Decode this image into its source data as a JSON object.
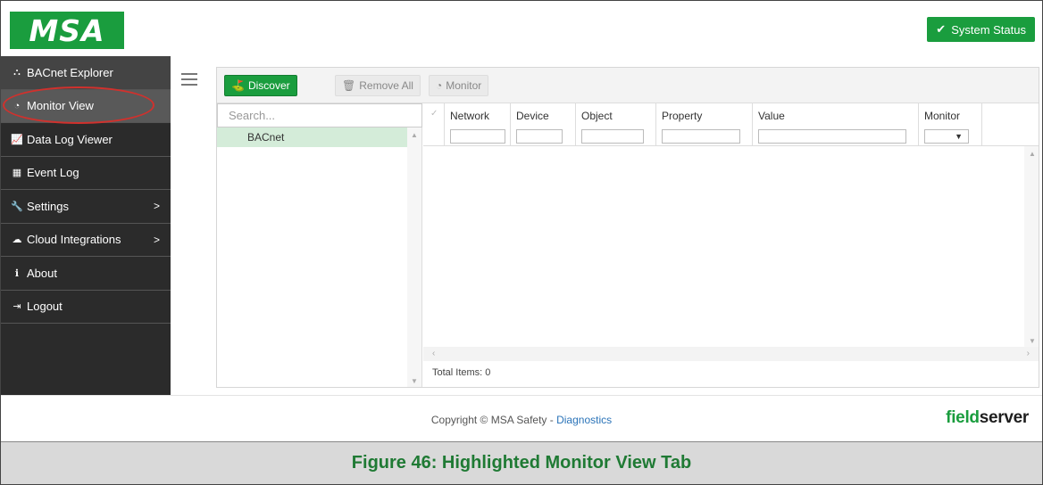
{
  "brand": {
    "logo_text": "MSA",
    "accent": "#1a9d3e",
    "sidebar_bg": "#2b2b2b"
  },
  "header": {
    "system_status_label": "System Status",
    "system_status_icon": "check-icon"
  },
  "sidebar": {
    "items": [
      {
        "label": "BACnet Explorer",
        "icon": "sitemap-icon"
      },
      {
        "label": "Monitor View",
        "icon": "tachometer-icon"
      },
      {
        "label": "Data Log Viewer",
        "icon": "line-chart-icon"
      },
      {
        "label": "Event Log",
        "icon": "calendar-icon"
      },
      {
        "label": "Settings",
        "icon": "wrench-icon",
        "chevron": ">"
      },
      {
        "label": "Cloud Integrations",
        "icon": "cloud-icon",
        "chevron": ">"
      },
      {
        "label": "About",
        "icon": "info-icon"
      },
      {
        "label": "Logout",
        "icon": "sign-out-icon"
      }
    ]
  },
  "toolbar": {
    "discover_label": "Discover",
    "remove_all_label": "Remove All",
    "monitor_label": "Monitor"
  },
  "tree": {
    "search_placeholder": "Search...",
    "items": [
      "BACnet"
    ]
  },
  "grid": {
    "columns": [
      "Network",
      "Device",
      "Object",
      "Property",
      "Value",
      "Monitor"
    ],
    "total_items": "Total Items: 0"
  },
  "footer": {
    "copyright": "Copyright © MSA Safety - ",
    "diagnostics_link": "Diagnostics",
    "logo_part1": "field",
    "logo_part2": "server"
  },
  "caption": "Figure 46: Highlighted Monitor View Tab"
}
